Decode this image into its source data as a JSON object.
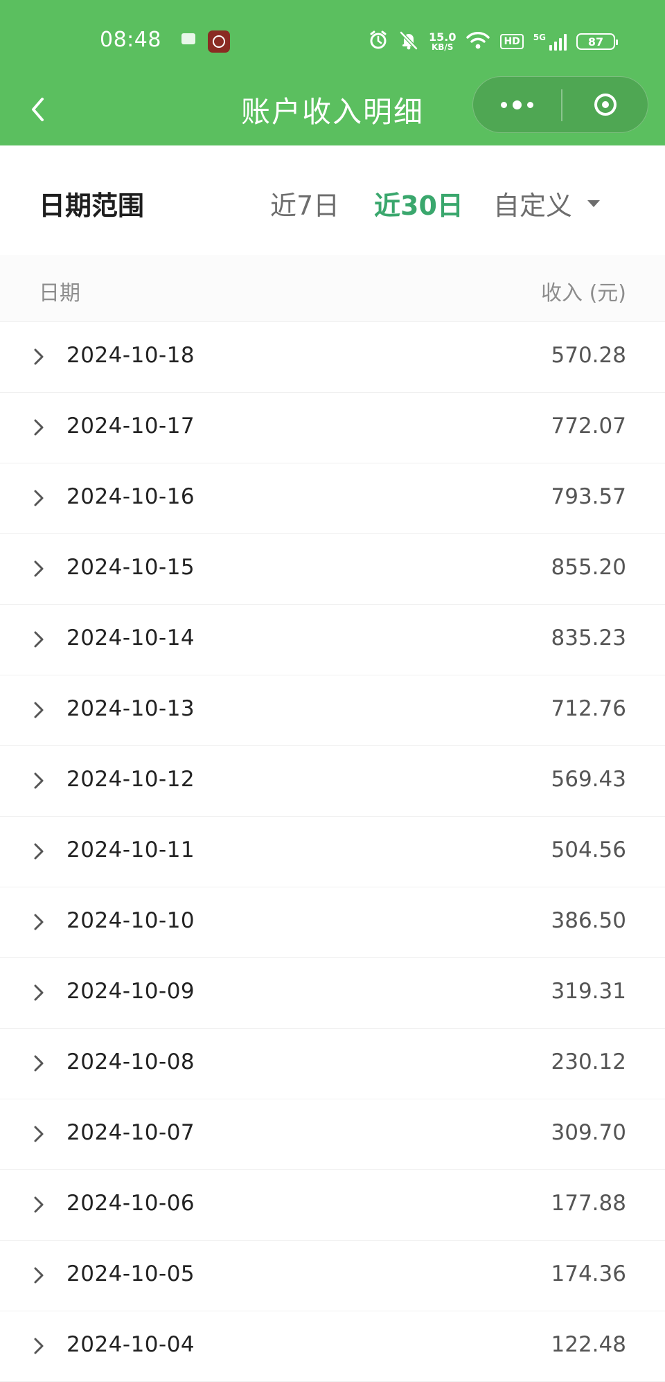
{
  "status_bar": {
    "time": "08:48",
    "network_speed": "15.0",
    "network_speed_unit": "KB/S",
    "hd_label": "HD",
    "signal_label": "5G",
    "battery": "87",
    "icons": [
      "message-icon",
      "app-notification-icon",
      "alarm-icon",
      "mute-bell-icon",
      "wifi-icon",
      "hd-icon",
      "signal-icon",
      "battery-icon"
    ]
  },
  "nav": {
    "title": "账户收入明细"
  },
  "filter": {
    "label": "日期范围",
    "options": [
      {
        "label": "近7日",
        "active": false
      },
      {
        "label": "近30日",
        "active": true
      },
      {
        "label": "自定义",
        "active": false
      }
    ]
  },
  "table": {
    "header_date": "日期",
    "header_income": "收入 (元)",
    "rows": [
      {
        "date": "2024-10-18",
        "amount": "570.28"
      },
      {
        "date": "2024-10-17",
        "amount": "772.07"
      },
      {
        "date": "2024-10-16",
        "amount": "793.57"
      },
      {
        "date": "2024-10-15",
        "amount": "855.20"
      },
      {
        "date": "2024-10-14",
        "amount": "835.23"
      },
      {
        "date": "2024-10-13",
        "amount": "712.76"
      },
      {
        "date": "2024-10-12",
        "amount": "569.43"
      },
      {
        "date": "2024-10-11",
        "amount": "504.56"
      },
      {
        "date": "2024-10-10",
        "amount": "386.50"
      },
      {
        "date": "2024-10-09",
        "amount": "319.31"
      },
      {
        "date": "2024-10-08",
        "amount": "230.12"
      },
      {
        "date": "2024-10-07",
        "amount": "309.70"
      },
      {
        "date": "2024-10-06",
        "amount": "177.88"
      },
      {
        "date": "2024-10-05",
        "amount": "174.36"
      },
      {
        "date": "2024-10-04",
        "amount": "122.48"
      }
    ]
  },
  "colors": {
    "header_green": "#5bbf5f",
    "active_green": "#3aa76d"
  }
}
